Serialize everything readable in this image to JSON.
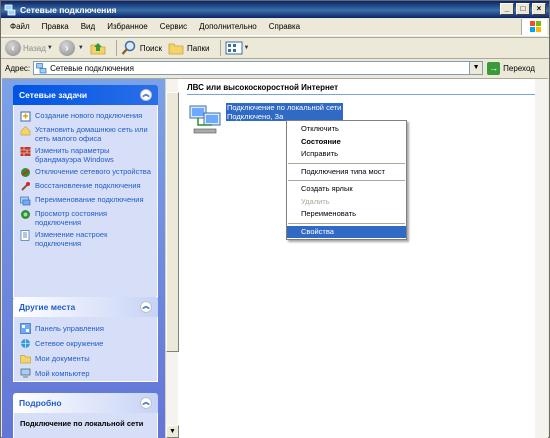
{
  "window": {
    "title": "Сетевые подключения"
  },
  "menubar": [
    "Файл",
    "Правка",
    "Вид",
    "Избранное",
    "Сервис",
    "Дополнительно",
    "Справка"
  ],
  "toolbar": {
    "back": "Назад",
    "search": "Поиск",
    "folders": "Папки"
  },
  "address": {
    "label": "Адрес:",
    "value": "Сетевые подключения",
    "go": "Переход"
  },
  "taskpane": {
    "network_tasks": {
      "title": "Сетевые задачи",
      "items": [
        "Создание нового подключения",
        "Установить домашнюю сеть или сеть малого офиса",
        "Изменить параметры брандмауэра Windows",
        "Отключение сетевого устройства",
        "Восстановление подключения",
        "Переименование подключения",
        "Просмотр состояния подключения",
        "Изменение настроек подключения"
      ]
    },
    "other_places": {
      "title": "Другие места",
      "items": [
        "Панель управления",
        "Сетевое окружение",
        "Мои документы",
        "Мой компьютер"
      ]
    },
    "details": {
      "title": "Подробно",
      "text": "Подключение по локальной сети"
    }
  },
  "main": {
    "group_title": "ЛВС или высокоскоростной Интернет",
    "connection": {
      "name": "Подключение по локальной сети",
      "status": "Подключено, За"
    }
  },
  "context_menu": {
    "items": [
      {
        "label": "Отключить",
        "style": "normal"
      },
      {
        "label": "Состояние",
        "style": "bold"
      },
      {
        "label": "Исправить",
        "style": "normal"
      },
      {
        "label": "Подключения типа мост",
        "style": "normal"
      },
      {
        "label": "Создать ярлык",
        "style": "normal"
      },
      {
        "label": "Удалить",
        "style": "disabled"
      },
      {
        "label": "Переименовать",
        "style": "normal"
      },
      {
        "label": "Свойства",
        "style": "selected"
      }
    ]
  },
  "colors": {
    "titlebar": "#0a246a",
    "selection": "#316ac5",
    "task_link": "#215dc6"
  }
}
